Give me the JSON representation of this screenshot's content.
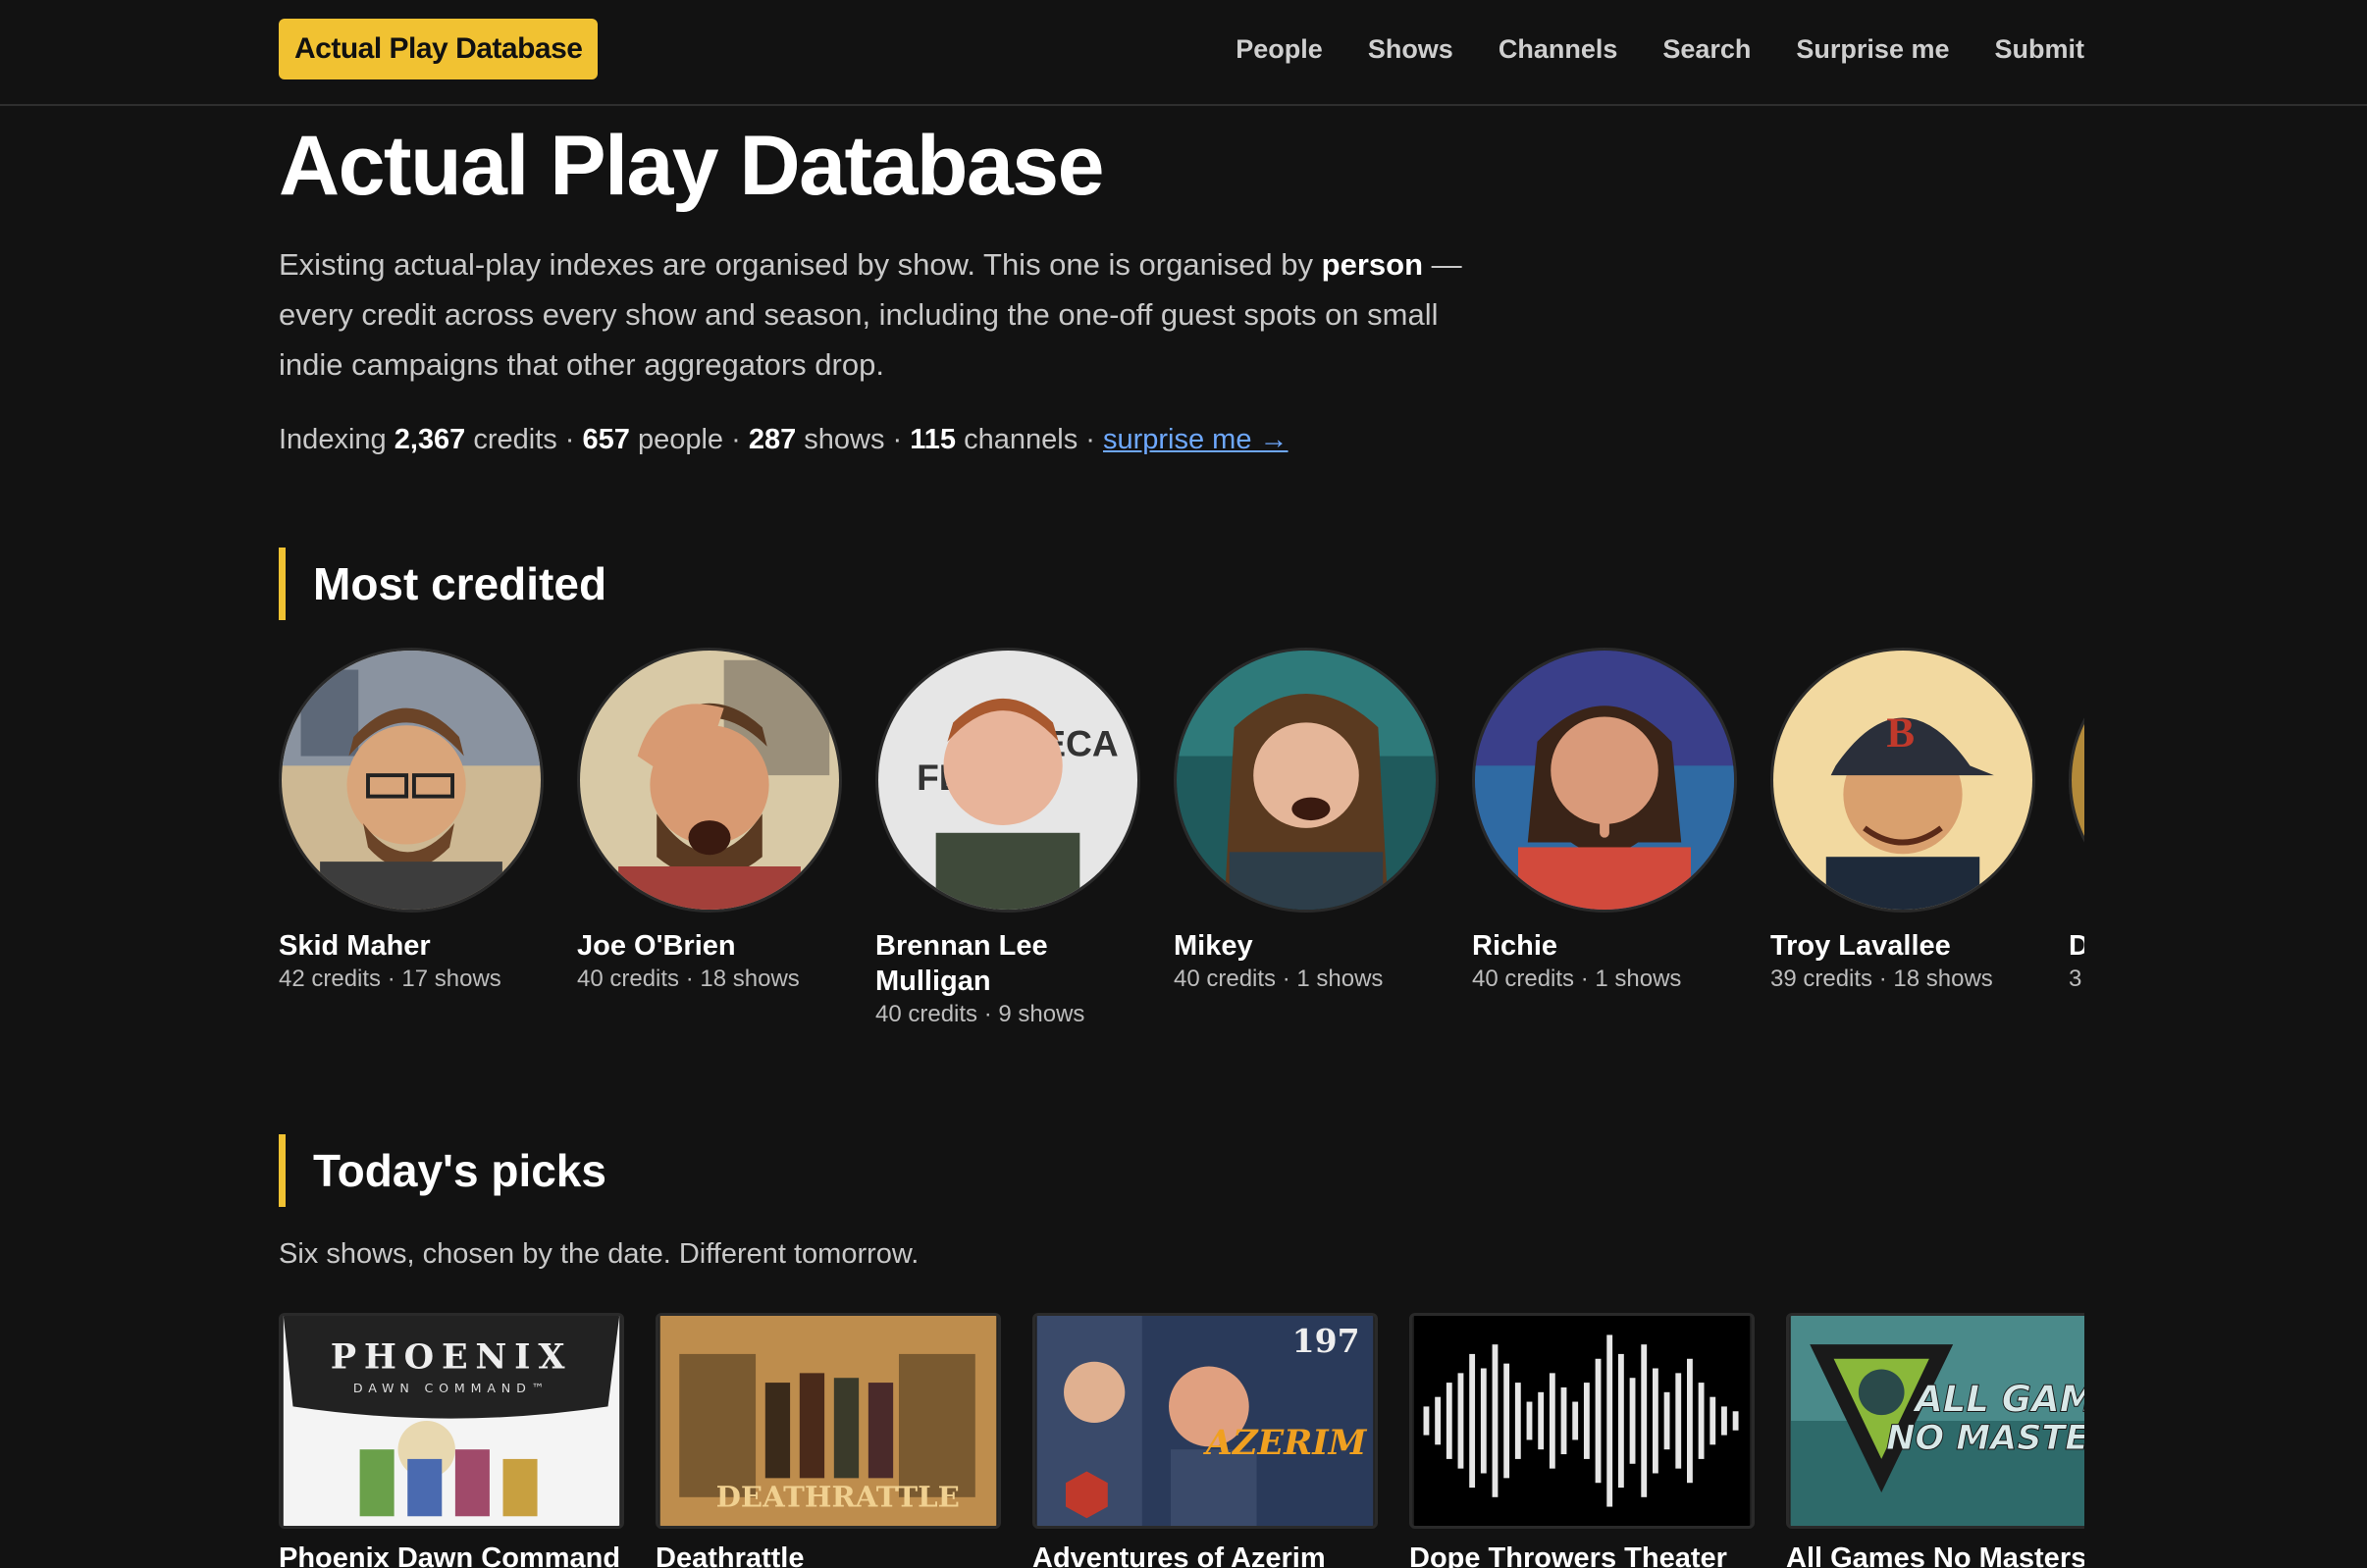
{
  "header": {
    "brand": "Actual Play Database",
    "nav": [
      "People",
      "Shows",
      "Channels",
      "Search",
      "Surprise me",
      "Submit"
    ]
  },
  "hero": {
    "title": "Actual Play Database",
    "intro_pre": "Existing actual-play indexes are organised by show. This one is organised by ",
    "intro_bold": "person",
    "intro_post": " — every credit across every show and season, including the one-off guest spots on small indie campaigns that other aggregators drop."
  },
  "stats": {
    "prefix": "Indexing ",
    "credits": "2,367",
    "credits_label": " credits · ",
    "people": "657",
    "people_label": " people · ",
    "shows": "287",
    "shows_label": " shows · ",
    "channels": "115",
    "channels_label": " channels · ",
    "surprise_link": "surprise me →"
  },
  "most_credited": {
    "title": "Most credited",
    "people": [
      {
        "name": "Skid Maher",
        "meta": "42 credits · 17 shows"
      },
      {
        "name": "Joe O'Brien",
        "meta": "40 credits · 18 shows"
      },
      {
        "name": "Brennan Lee Mulligan",
        "meta": "40 credits · 9 shows"
      },
      {
        "name": "Mikey",
        "meta": "40 credits · 1 shows"
      },
      {
        "name": "Richie",
        "meta": "40 credits · 1 shows"
      },
      {
        "name": "Troy Lavallee",
        "meta": "39 credits · 18 shows"
      },
      {
        "name": "D",
        "meta": "3"
      }
    ]
  },
  "todays_picks": {
    "title": "Today's picks",
    "subtitle": "Six shows, chosen by the date. Different tomorrow.",
    "shows": [
      {
        "title": "Phoenix Dawn Command",
        "thumb_text": "PHOENIX",
        "thumb_sub": "DAWN COMMAND™"
      },
      {
        "title": "Deathrattle",
        "thumb_text": "DEATHRATTLE"
      },
      {
        "title": "Adventures of Azerim",
        "thumb_text": "AZERIM",
        "thumb_num": "197"
      },
      {
        "title": "Dope Throwers Theater"
      },
      {
        "title": "All Games No Masters",
        "thumb_text": "ALL GAMES",
        "thumb_sub": "NO MASTERS"
      }
    ]
  },
  "colors": {
    "accent": "#f1c232",
    "link": "#6ea8fe",
    "background": "#121212"
  }
}
